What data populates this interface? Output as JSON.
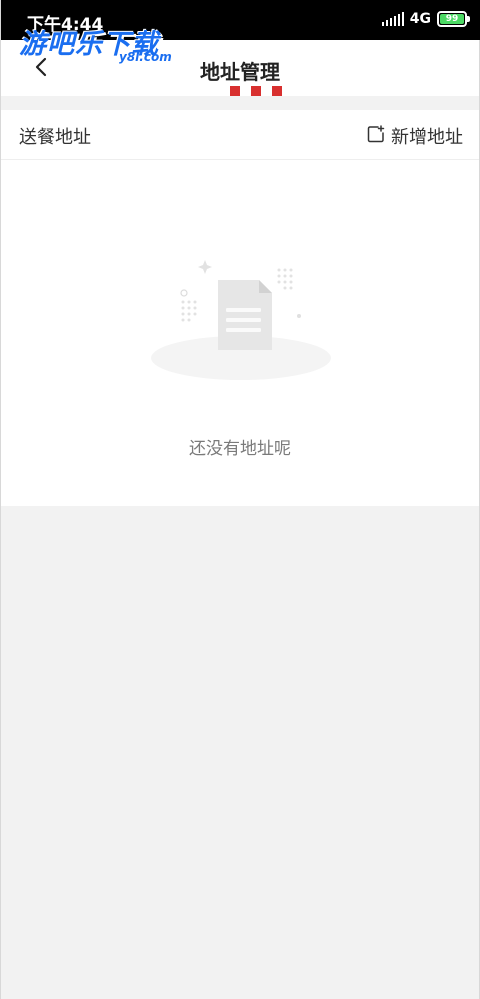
{
  "status_bar": {
    "time": "下午4:44",
    "network": "4G",
    "battery": "99"
  },
  "watermark": {
    "title": "游吧乐下载",
    "subtitle": "y8l.com"
  },
  "header": {
    "title": "地址管理"
  },
  "address_section": {
    "label": "送餐地址",
    "add_label": "新增地址"
  },
  "empty_state": {
    "message": "还没有地址呢"
  },
  "colors": {
    "accent": "#d8302f",
    "watermark_blue": "#1a6ef0"
  }
}
